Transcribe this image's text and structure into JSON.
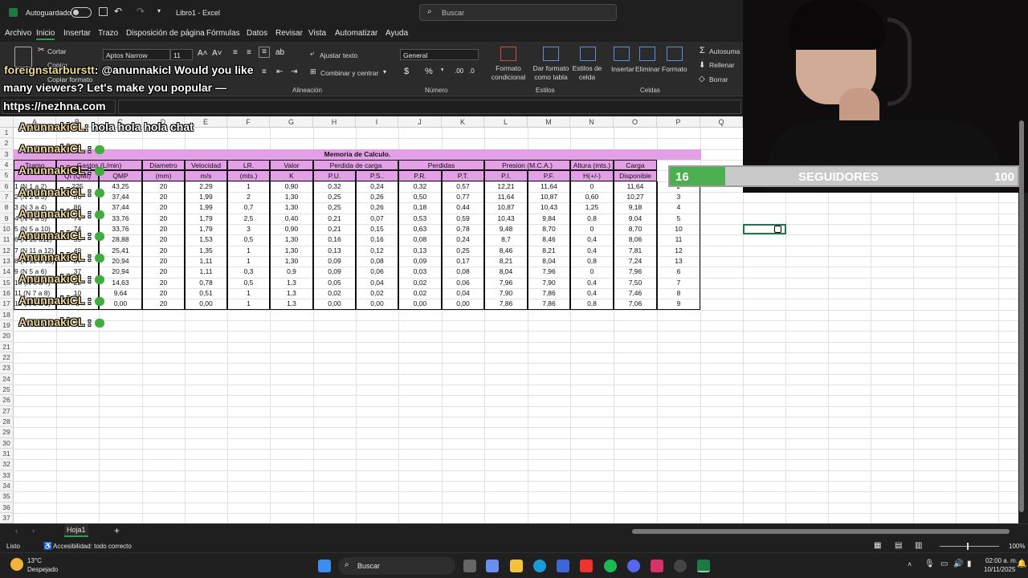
{
  "titlebar": {
    "autosave_label": "Autoguardado",
    "doc_title": "Libro1 - Excel",
    "search_placeholder": "Buscar"
  },
  "menu": [
    "Archivo",
    "Inicio",
    "Insertar",
    "Trazo",
    "Disposición de página",
    "Fórmulas",
    "Datos",
    "Revisar",
    "Vista",
    "Automatizar",
    "Ayuda"
  ],
  "ribbon": {
    "cut": "Cortar",
    "copy": "Copiar",
    "copy_format": "Copiar formato",
    "font_name": "Aptos Narrow",
    "font_size": "11",
    "wrap_text": "Ajustar texto",
    "merge_center": "Combinar y centrar",
    "number_format": "General",
    "cond_format": "Formato condicional",
    "table_format": "Dar formato como tabla",
    "cell_styles": "Estilos de celda",
    "insert": "Insertar",
    "delete": "Eliminar",
    "format": "Formato",
    "autosum": "Autosuma",
    "fill": "Rellenar",
    "clear": "Borrar",
    "group_alignment": "Alineación",
    "group_number": "Número",
    "group_styles": "Estilos",
    "group_cells": "Celdas"
  },
  "columns": [
    "B",
    "C",
    "D",
    "E",
    "F",
    "G",
    "H",
    "I",
    "J",
    "K",
    "L",
    "M",
    "N",
    "O",
    "P",
    "Q"
  ],
  "sheet": {
    "title": "Memoria de Calculo.",
    "headers_top": [
      "Tramo",
      "Gastos (L/min)",
      "Diametro",
      "Velocidad",
      "LR.",
      "Valor",
      "Perdida de carga",
      "Perdidas",
      "Presion (M.C.A.)",
      "Altura (mts.)",
      "Carga"
    ],
    "headers_bottom": [
      "",
      "QI (QMI)",
      "QMP",
      "(mm)",
      "m/s",
      "(mts.)",
      "K",
      "P.U.",
      "P.S..",
      "P.R.",
      "P.T.",
      "P.I.",
      "P.F.",
      "H(+/-)",
      "Disponible"
    ],
    "rows": [
      [
        "1 (N 1 a 2)",
        "225",
        "43,25",
        "20",
        "2,29",
        "1",
        "0,90",
        "0,32",
        "0,24",
        "0,32",
        "0,57",
        "12,21",
        "11,64",
        "0",
        "11,64",
        "2"
      ],
      [
        "2 (N 2 a 3)",
        "86",
        "37,44",
        "20",
        "1,99",
        "2",
        "1,30",
        "0,25",
        "0,26",
        "0,50",
        "0,77",
        "11,64",
        "10,87",
        "0,60",
        "10,27",
        "3"
      ],
      [
        "3 (N 3 a 4)",
        "86",
        "37,44",
        "20",
        "1,99",
        "0,7",
        "1,30",
        "0,25",
        "0,26",
        "0,18",
        "0,44",
        "10,87",
        "10,43",
        "1,25",
        "9,18",
        "4"
      ],
      [
        "4 (N 4 a 5)",
        "74",
        "33,76",
        "20",
        "1,79",
        "2,5",
        "0,40",
        "0,21",
        "0,07",
        "0,53",
        "0,59",
        "10,43",
        "9,84",
        "0,8",
        "9,04",
        "5"
      ],
      [
        "5 (N 5 a 10)",
        "74",
        "33,76",
        "20",
        "1,79",
        "3",
        "0,90",
        "0,21",
        "0,15",
        "0,63",
        "0,78",
        "9,48",
        "8,70",
        "0",
        "8,70",
        "10"
      ],
      [
        "6 (N 10 a11)",
        "59",
        "28,88",
        "20",
        "1,53",
        "0,5",
        "1,30",
        "0,16",
        "0,16",
        "0,08",
        "0,24",
        "8,7",
        "8,46",
        "0,4",
        "8,06",
        "11"
      ],
      [
        "7 (N 11 a 12)",
        "49",
        "25,41",
        "20",
        "1,35",
        "1",
        "1,30",
        "0,13",
        "0,12",
        "0,13",
        "0,25",
        "8,46",
        "8,21",
        "0,4",
        "7,81",
        "12"
      ],
      [
        "8 (N 12 a 13)",
        "37",
        "20,94",
        "20",
        "1,11",
        "1",
        "1,30",
        "0,09",
        "0,08",
        "0,09",
        "0,17",
        "8,21",
        "8,04",
        "0,8",
        "7,24",
        "13"
      ],
      [
        "9 (N 5 a 6)",
        "37",
        "20,94",
        "20",
        "1,11",
        "0,3",
        "0,9",
        "0,09",
        "0,06",
        "0,03",
        "0,08",
        "8,04",
        "7,96",
        "0",
        "7,96",
        "6"
      ],
      [
        "10 (N 6 a 7)",
        "22",
        "14,63",
        "20",
        "0,78",
        "0,5",
        "1,3",
        "0,05",
        "0,04",
        "0,02",
        "0,06",
        "7,96",
        "7,90",
        "0,4",
        "7,50",
        "7"
      ],
      [
        "11 (N 7 a 8)",
        "10",
        "9,64",
        "20",
        "0,51",
        "1",
        "1,3",
        "0,02",
        "0,02",
        "0,02",
        "0,04",
        "7,90",
        "7,86",
        "0,4",
        "7,46",
        "8"
      ],
      [
        "12 (N 8 a 9)",
        "0",
        "0,00",
        "20",
        "0,00",
        "1",
        "1,3",
        "0,00",
        "0,00",
        "0,00",
        "0,00",
        "7,86",
        "7,86",
        "0,8",
        "7,06",
        "9"
      ]
    ]
  },
  "overlay": {
    "chat_user_line1": "foreignstarburstt",
    "chat_msg_line1": ": @anunnakicl Would you like",
    "chat_line2": "many viewers? Let's make you popular —",
    "chat_line3": "https://nezhna.com",
    "chat_user": "AnunnakiCL",
    "chat_greeting": ": hola hola hola chat",
    "followers_count": "16",
    "followers_label": "SEGUIDORES",
    "followers_goal": "100",
    "followers_progress": 0.16
  },
  "sheettab": {
    "name": "Hoja1",
    "add": "+"
  },
  "status": {
    "ready": "Listo",
    "accessibility": "Accesibilidad: todo correcto",
    "zoom": "100%"
  },
  "taskbar": {
    "temp": "13°C",
    "weather": "Despejado",
    "search": "Buscar",
    "time": "02:00 a. m.",
    "date": "10/11/2025"
  }
}
